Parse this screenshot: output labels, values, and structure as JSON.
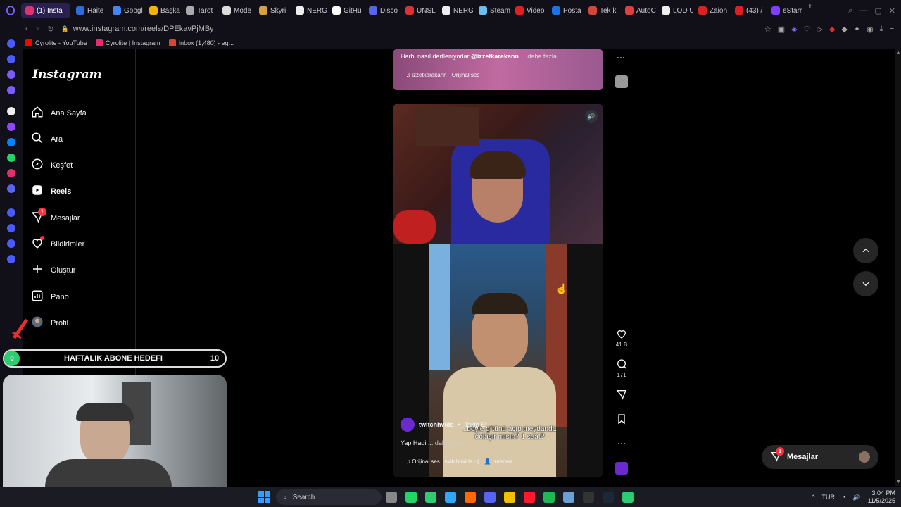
{
  "browser": {
    "tabs": [
      {
        "label": "(1) Insta",
        "color": "#e1306c",
        "active": true
      },
      {
        "label": "Haite",
        "color": "#2d6cdf"
      },
      {
        "label": "Googl",
        "color": "#4285f4"
      },
      {
        "label": "Başka",
        "color": "#f2b400"
      },
      {
        "label": "Tarot",
        "color": "#aaaaaa"
      },
      {
        "label": "Mode",
        "color": "#dddddd"
      },
      {
        "label": "Skyri",
        "color": "#d8a040"
      },
      {
        "label": "NERG",
        "color": "#eeeeee"
      },
      {
        "label": "GitHu",
        "color": "#ffffff"
      },
      {
        "label": "Disco",
        "color": "#5865f2"
      },
      {
        "label": "UNSL",
        "color": "#e03030"
      },
      {
        "label": "NERG",
        "color": "#eeeeee"
      },
      {
        "label": "Steam",
        "color": "#66c0f4"
      },
      {
        "label": "Video",
        "color": "#e02020"
      },
      {
        "label": "Posta",
        "color": "#1a73e8"
      },
      {
        "label": "Tek k",
        "color": "#d44638"
      },
      {
        "label": "AutoC",
        "color": "#e04040"
      },
      {
        "label": "LOD U",
        "color": "#eeeeee"
      },
      {
        "label": "Zaion",
        "color": "#e02020"
      },
      {
        "label": "(43) /",
        "color": "#e02020"
      },
      {
        "label": "eStarr",
        "color": "#8040ff"
      }
    ],
    "url": "www.instagram.com/reels/DPEkavPjMBy",
    "bookmarks": [
      {
        "label": "Cyrolite - YouTube",
        "color": "#ff0000"
      },
      {
        "label": "Cyrolite | Instagram",
        "color": "#e1306c"
      },
      {
        "label": "Inbox (1,480) - eg...",
        "color": "#d44638"
      }
    ]
  },
  "instagram": {
    "logo": "Instagram",
    "nav": [
      {
        "label": "Ana Sayfa",
        "icon": "home-icon"
      },
      {
        "label": "Ara",
        "icon": "search-icon"
      },
      {
        "label": "Keşfet",
        "icon": "compass-icon"
      },
      {
        "label": "Reels",
        "icon": "reels-icon",
        "bold": true
      },
      {
        "label": "Mesajlar",
        "icon": "messenger-icon",
        "badge": "1"
      },
      {
        "label": "Bildirimler",
        "icon": "heart-icon"
      },
      {
        "label": "Oluştur",
        "icon": "plus-icon"
      },
      {
        "label": "Pano",
        "icon": "dashboard-icon"
      },
      {
        "label": "Profil",
        "icon": "avatar-icon"
      }
    ],
    "prev_reel": {
      "caption_start": "Harbi nasıl dertleniyorlar ",
      "caption_mention": "@izzetkarakann",
      "caption_more": " ... daha fazla",
      "audio": "izzetkarakann · Orijinal ses"
    },
    "current_reel": {
      "username": "twitchhvids",
      "follow": "Takip Et",
      "caption": "Yap Hadi",
      "caption_more": "... daha fazla",
      "audio": "Orijinal ses",
      "audio_author": "twitchhvids · (",
      "tagged": "rraenee",
      "subtitle_line1": "..böyle g*tünü açıp meydanda",
      "subtitle_line2": "dolaşır mısın? 1 saat?"
    },
    "actions": {
      "likes": "41 B",
      "comments": "171"
    },
    "messages_pill": {
      "label": "Mesajlar",
      "badge": "1"
    }
  },
  "stream_overlay": {
    "goal_start": "0",
    "goal_title": "HAFTALIK ABONE HEDEFI",
    "goal_end": "10"
  },
  "taskbar": {
    "search_placeholder": "Search",
    "language": "TUR",
    "time": "3:04 PM",
    "date": "11/5/2025"
  }
}
